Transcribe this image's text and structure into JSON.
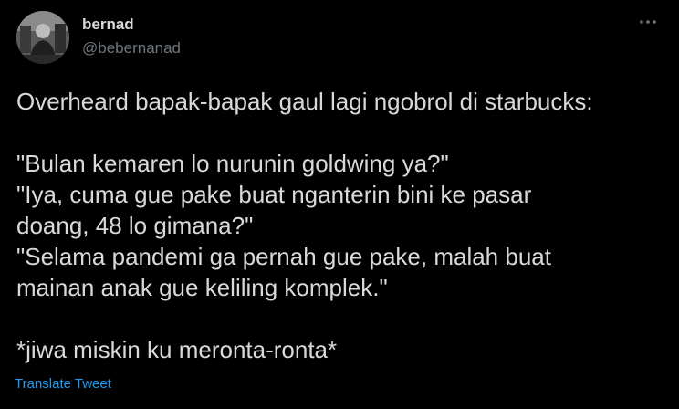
{
  "author": {
    "name": "bernad",
    "handle": "@bebernanad"
  },
  "tweet": {
    "line_1": "Overheard bapak-bapak gaul lagi ngobrol di starbucks:",
    "quote_1": "\"Bulan kemaren lo nurunin goldwing ya?\"",
    "quote_2a": "\"Iya, cuma gue pake buat nganterin bini ke pasar",
    "quote_2b": "doang, 48 lo gimana?\"",
    "quote_3a": "\"Selama pandemi ga pernah gue pake, malah buat",
    "quote_3b": "mainan anak gue keliling komplek.\"",
    "closing": "*jiwa miskin ku meronta-ronta*"
  },
  "actions": {
    "translate_label": "Translate Tweet"
  },
  "icons": {
    "more": "more-horizontal-icon"
  },
  "colors": {
    "background": "#000000",
    "text": "#d9d9d9",
    "muted": "#6e767d",
    "link": "#1d9bf0"
  }
}
